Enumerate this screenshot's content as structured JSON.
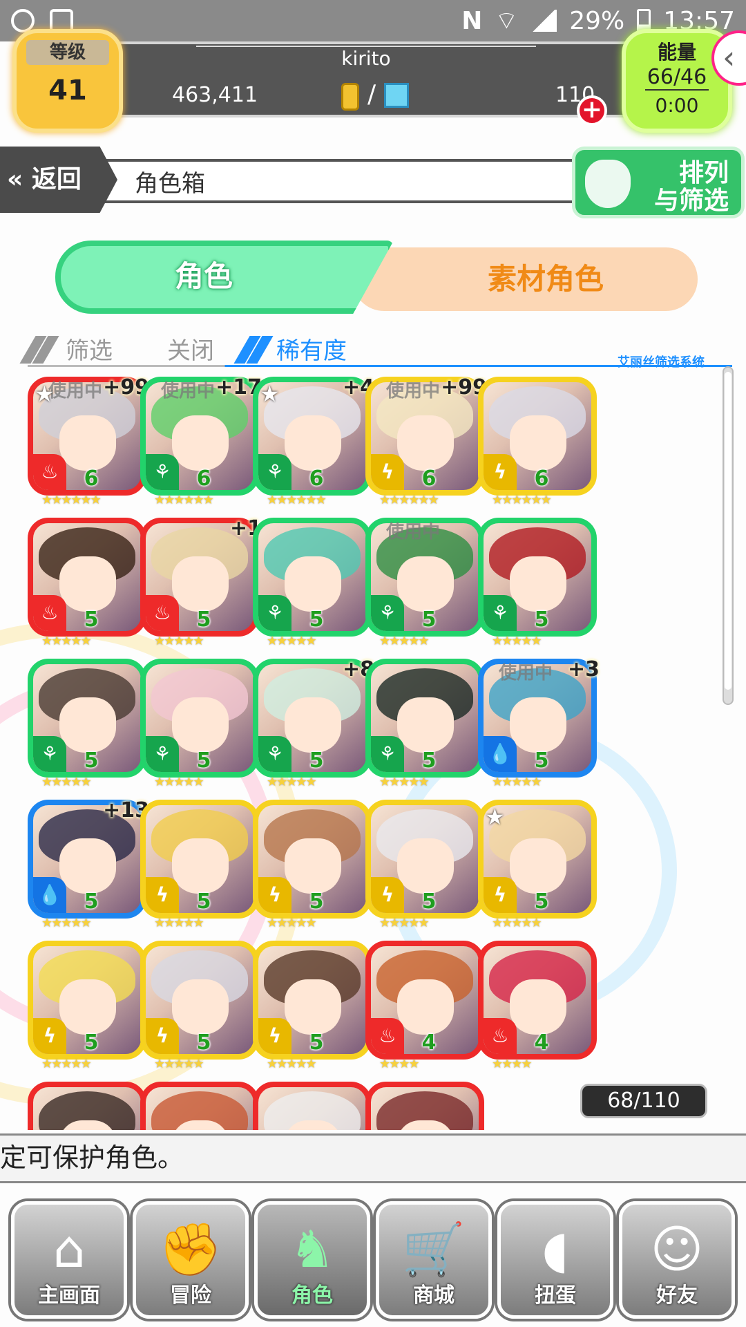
{
  "status_bar": {
    "nfc": "N",
    "battery": "29%",
    "time": "13:57"
  },
  "header": {
    "level_label": "等级",
    "level_value": "41",
    "username": "kirito",
    "gold": "463,411",
    "separator": "/",
    "gems": "110",
    "energy_label": "能量",
    "energy_value": "66/46",
    "energy_timer": "0:00"
  },
  "nav": {
    "back_label": "返回",
    "page_title": "角色箱",
    "sort_filter_label_1": "排列",
    "sort_filter_label_2": "与筛选"
  },
  "tabs": {
    "characters": "角色",
    "materials": "素材角色"
  },
  "filter": {
    "filter_label": "筛选",
    "state_label": "关闭",
    "sort_label": "稀有度",
    "system_label": "艾丽丝筛选系统"
  },
  "in_use_label": "使用中",
  "cards": [
    {
      "color": "red",
      "hair": "#cfcfd8",
      "level": "6",
      "stars": "★★★★★★",
      "plus": "+99",
      "in_use": true,
      "top_star": true
    },
    {
      "color": "green",
      "hair": "#5fcf6a",
      "level": "6",
      "stars": "★★★★★★",
      "plus": "+17",
      "in_use": true,
      "top_star": false
    },
    {
      "color": "green",
      "hair": "#e6e6ee",
      "level": "6",
      "stars": "★★★★★★",
      "plus": "+4",
      "in_use": false,
      "top_star": true
    },
    {
      "color": "yellow",
      "hair": "#f4e7c2",
      "level": "6",
      "stars": "★★★★★★",
      "plus": "+99",
      "in_use": true,
      "top_star": false
    },
    {
      "color": "yellow",
      "hair": "#d9d9e6",
      "level": "6",
      "stars": "★★★★★★",
      "plus": "",
      "in_use": false,
      "top_star": false
    },
    {
      "color": "red",
      "hair": "#3a2418",
      "level": "5",
      "stars": "★★★★★",
      "plus": "",
      "in_use": false,
      "top_star": false
    },
    {
      "color": "red",
      "hair": "#e9d6a4",
      "level": "5",
      "stars": "★★★★★",
      "plus": "+1",
      "in_use": false,
      "top_star": false
    },
    {
      "color": "green",
      "hair": "#50c9b3",
      "level": "5",
      "stars": "★★★★★",
      "plus": "",
      "in_use": false,
      "top_star": false
    },
    {
      "color": "green",
      "hair": "#2f8f44",
      "level": "5",
      "stars": "★★★★★",
      "plus": "",
      "in_use": true,
      "top_star": false
    },
    {
      "color": "green",
      "hair": "#b01c22",
      "level": "5",
      "stars": "★★★★★",
      "plus": "",
      "in_use": false,
      "top_star": false
    },
    {
      "color": "green",
      "hair": "#4a3b33",
      "level": "5",
      "stars": "★★★★★",
      "plus": "",
      "in_use": false,
      "top_star": false
    },
    {
      "color": "green",
      "hair": "#f2c7d2",
      "level": "5",
      "stars": "★★★★★",
      "plus": "",
      "in_use": false,
      "top_star": false
    },
    {
      "color": "green",
      "hair": "#cfeee0",
      "level": "5",
      "stars": "★★★★★",
      "plus": "+8",
      "in_use": false,
      "top_star": false
    },
    {
      "color": "green",
      "hair": "#1d2a25",
      "level": "5",
      "stars": "★★★★★",
      "plus": "",
      "in_use": false,
      "top_star": false
    },
    {
      "color": "blue",
      "hair": "#3ea4c8",
      "level": "5",
      "stars": "★★★★★",
      "plus": "+3",
      "in_use": true,
      "top_star": false
    },
    {
      "color": "blue",
      "hair": "#2c2a48",
      "level": "5",
      "stars": "★★★★★",
      "plus": "+13",
      "in_use": false,
      "top_star": false
    },
    {
      "color": "yellow",
      "hair": "#f1cd4e",
      "level": "5",
      "stars": "★★★★★",
      "plus": "",
      "in_use": false,
      "top_star": false
    },
    {
      "color": "yellow",
      "hair": "#b7774d",
      "level": "5",
      "stars": "★★★★★",
      "plus": "",
      "in_use": false,
      "top_star": false
    },
    {
      "color": "yellow",
      "hair": "#e8e8ee",
      "level": "5",
      "stars": "★★★★★",
      "plus": "",
      "in_use": false,
      "top_star": false
    },
    {
      "color": "yellow",
      "hair": "#f3d7a2",
      "level": "5",
      "stars": "★★★★★",
      "plus": "",
      "in_use": false,
      "top_star": true
    },
    {
      "color": "yellow",
      "hair": "#f3dc52",
      "level": "5",
      "stars": "★★★★★",
      "plus": "",
      "in_use": false,
      "top_star": false
    },
    {
      "color": "yellow",
      "hair": "#d8d8e2",
      "level": "5",
      "stars": "★★★★★",
      "plus": "",
      "in_use": false,
      "top_star": false
    },
    {
      "color": "yellow",
      "hair": "#5a3b2a",
      "level": "5",
      "stars": "★★★★★",
      "plus": "",
      "in_use": false,
      "top_star": false
    },
    {
      "color": "red",
      "hair": "#c8632e",
      "level": "4",
      "stars": "★★★★",
      "plus": "",
      "in_use": false,
      "top_star": false
    },
    {
      "color": "red",
      "hair": "#d62648",
      "level": "4",
      "stars": "★★★★",
      "plus": "",
      "in_use": false,
      "top_star": false
    },
    {
      "color": "red",
      "hair": "#3a2a25",
      "level": "",
      "stars": "",
      "plus": "",
      "in_use": false,
      "top_star": false
    },
    {
      "color": "red",
      "hair": "#c85a36",
      "level": "",
      "stars": "",
      "plus": "",
      "in_use": false,
      "top_star": false
    },
    {
      "color": "red",
      "hair": "#eeeeee",
      "level": "",
      "stars": "",
      "plus": "",
      "in_use": false,
      "top_star": false
    },
    {
      "color": "red",
      "hair": "#7a2a2a",
      "level": "",
      "stars": "",
      "plus": "",
      "in_use": false,
      "top_star": false
    }
  ],
  "box_count": "68/110",
  "message": "定可保护角色。",
  "bottom_nav": [
    {
      "label": "主画面",
      "icon": "⌂",
      "name": "home"
    },
    {
      "label": "冒险",
      "icon": "✊",
      "name": "adventure"
    },
    {
      "label": "角色",
      "icon": "♞",
      "name": "character",
      "active": true
    },
    {
      "label": "商城",
      "icon": "🛒",
      "name": "shop"
    },
    {
      "label": "扭蛋",
      "icon": "◖",
      "name": "gacha"
    },
    {
      "label": "好友",
      "icon": "☺",
      "name": "friends"
    }
  ],
  "colors": {
    "red": "#ee2a2a",
    "green": "#22d36b",
    "yellow": "#f6d21f",
    "blue": "#1d86f0",
    "accent_tab": "#7ef2b7",
    "material_tab": "#fcd7b5"
  }
}
